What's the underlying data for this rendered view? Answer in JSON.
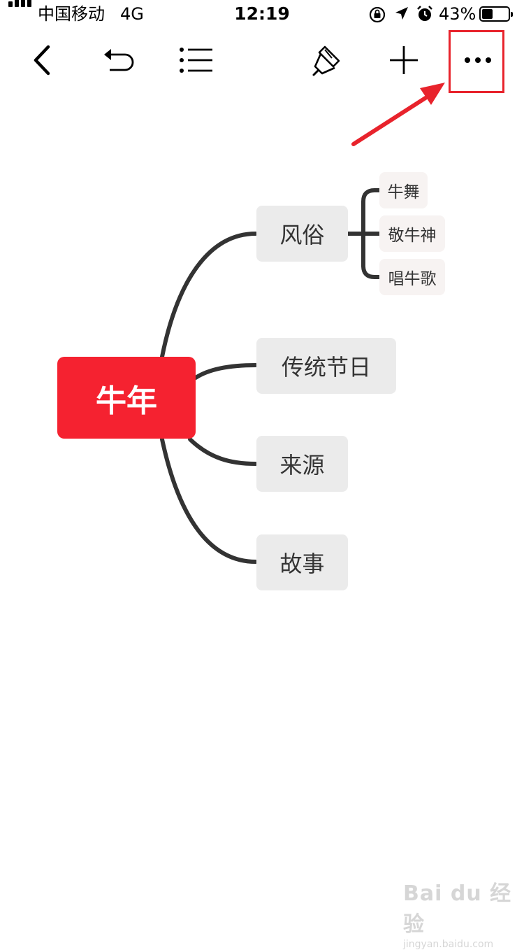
{
  "status_bar": {
    "carrier": "中国移动",
    "network": "4G",
    "time": "12:19",
    "battery_percent_label": "43%",
    "battery_level": 0.43,
    "icons": [
      "signal-icon",
      "orientation-lock-icon",
      "location-icon",
      "alarm-icon",
      "battery-icon"
    ]
  },
  "toolbar": {
    "buttons": [
      "back-icon",
      "undo-icon",
      "outline-list-icon",
      "format-brush-icon",
      "add-icon",
      "more-icon"
    ]
  },
  "annotation": {
    "color": "#e8232c",
    "target": "more-icon"
  },
  "mindmap": {
    "root": "牛年",
    "branches": [
      {
        "label": "风俗",
        "children": [
          "牛舞",
          "敬牛神",
          "唱牛歌"
        ]
      },
      {
        "label": "传统节日"
      },
      {
        "label": "来源"
      },
      {
        "label": "故事"
      }
    ]
  },
  "colors": {
    "root_fill": "#f52230",
    "branch_fill": "#ebebeb",
    "leaf_fill": "#f7f3f2",
    "connector": "#333333"
  },
  "watermark": {
    "logo": "Bai du 经验",
    "url": "jingyan.baidu.com"
  }
}
